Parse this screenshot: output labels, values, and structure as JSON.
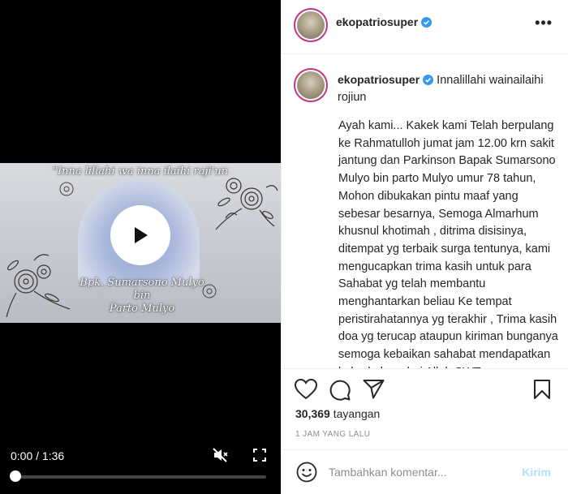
{
  "video": {
    "frame_quote": "\"Inna lillahi wa inna ilaihi raji'un",
    "frame_caption_line1": "Bpk. Sumarsono Mulyo",
    "frame_caption_line2": "bin",
    "frame_caption_line3": "Parto Mulyo",
    "time": "0:00 / 1:36",
    "progress": 0.0
  },
  "post": {
    "username": "ekopatriosuper",
    "more_label": "•••",
    "caption_first": "Innalillahi wainailaihi rojiun",
    "caption_body": "Ayah kami... Kakek kami Telah berpulang ke Rahmatulloh jumat jam 12.00 krn sakit jantung dan Parkinson Bapak Sumarsono Mulyo bin parto Mulyo umur 78 tahun,\nMohon dibukakan pintu maaf yang sebesar besarnya, Semoga Almarhum khusnul khotimah , ditrima disisinya, ditempat yg terbaik surga tentunya, kami mengucapkan trima kasih untuk para Sahabat yg telah membantu menghantarkan beliau Ke tempat peristirahatannya yg terakhir , Trima kasih doa yg terucap ataupun kiriman bunganya semoga kebaikan sahabat mendapatkan keberkahan dari Allah SWT",
    "views_count": "30,369",
    "views_label": "tayangan",
    "time_ago": "1 JAM YANG LALU"
  },
  "comment": {
    "placeholder": "Tambahkan komentar...",
    "post_label": "Kirim"
  },
  "colors": {
    "verified": "#3897f0",
    "post_disabled": "#b2dffc",
    "avatar_ring": "#c13584"
  }
}
